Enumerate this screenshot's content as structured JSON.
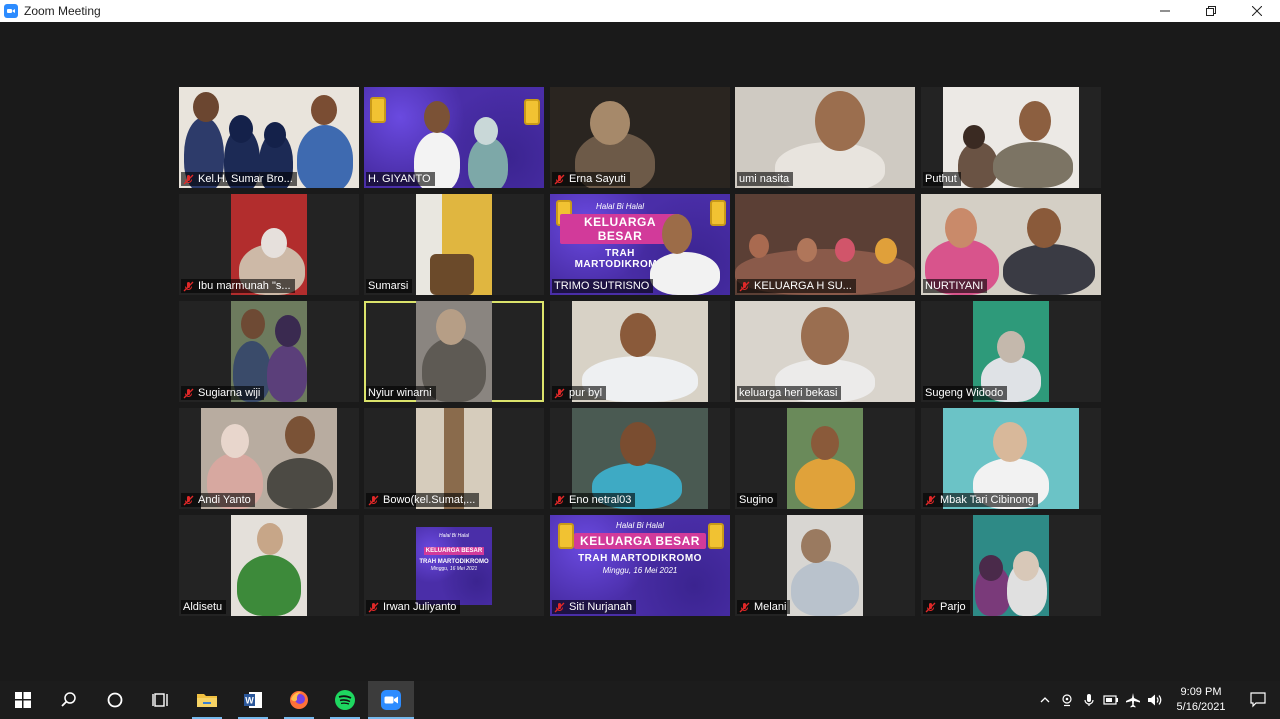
{
  "window": {
    "title": "Zoom Meeting"
  },
  "banner": {
    "line1": "Halal Bi Halal",
    "line2": "KELUARGA BESAR",
    "line3": "TRAH MARTODIKROMO",
    "line4": "Minggu, 16 Mei 2021"
  },
  "participants": [
    {
      "name": "Kel.H. Sumar Bro...",
      "muted": true
    },
    {
      "name": "H. GIYANTO",
      "muted": false
    },
    {
      "name": "Erna Sayuti",
      "muted": true
    },
    {
      "name": "umi nasita",
      "muted": false
    },
    {
      "name": "Puthut",
      "muted": false
    },
    {
      "name": "Ibu marmunah \"s...",
      "muted": true
    },
    {
      "name": "Sumarsi",
      "muted": false
    },
    {
      "name": "TRIMO SUTRISNO",
      "muted": false
    },
    {
      "name": "KELUARGA H SU...",
      "muted": true
    },
    {
      "name": "NURTIYANI",
      "muted": false
    },
    {
      "name": "Sugiarna wiji",
      "muted": true
    },
    {
      "name": "Nyiur winarni",
      "muted": false
    },
    {
      "name": "pur byl",
      "muted": true
    },
    {
      "name": "keluarga heri bekasi",
      "muted": false
    },
    {
      "name": "Sugeng Widodo",
      "muted": false
    },
    {
      "name": "Andi Yanto",
      "muted": true
    },
    {
      "name": "Bowo(kel.Sumat,...",
      "muted": true
    },
    {
      "name": "Eno netral03",
      "muted": true
    },
    {
      "name": "Sugino",
      "muted": false
    },
    {
      "name": "Mbak Tari Cibinong",
      "muted": true
    },
    {
      "name": "Aldisetu",
      "muted": false
    },
    {
      "name": "Irwan Juliyanto",
      "muted": true
    },
    {
      "name": "Siti Nurjanah",
      "muted": true
    },
    {
      "name": "Melani",
      "muted": true
    },
    {
      "name": "Parjo",
      "muted": true
    }
  ],
  "taskbar": {
    "apps": [
      "start",
      "search",
      "cortana",
      "task-view",
      "file-explorer",
      "word",
      "firefox",
      "spotify",
      "zoom"
    ],
    "time": "9:09 PM",
    "date": "5/16/2021"
  },
  "colors": {
    "active_speaker": "#dbe36b",
    "muted_icon": "#e02828",
    "banner": "#4a2ea8"
  }
}
